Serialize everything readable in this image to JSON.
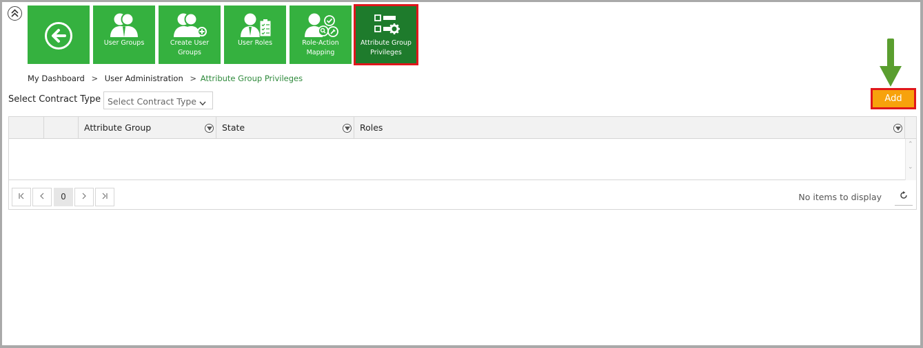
{
  "tiles": [
    {
      "label": "",
      "icon": "back-arrow-icon"
    },
    {
      "label": "User Groups",
      "icon": "user-groups-icon"
    },
    {
      "label": "Create User Groups",
      "icon": "create-user-group-icon"
    },
    {
      "label": "User Roles",
      "icon": "user-roles-icon"
    },
    {
      "label": "Role-Action Mapping",
      "icon": "role-action-mapping-icon"
    },
    {
      "label": "Attribute Group Privileges",
      "icon": "attribute-group-privileges-icon",
      "active": true
    }
  ],
  "breadcrumb": {
    "items": [
      "My Dashboard",
      "User Administration",
      "Attribute Group Privileges"
    ],
    "separator": ">"
  },
  "contract_type": {
    "label": "Select Contract Type",
    "placeholder": "Select Contract Type"
  },
  "add_button": {
    "label": "Add"
  },
  "grid": {
    "columns": [
      "",
      "",
      "Attribute Group",
      "State",
      "Roles"
    ],
    "rows": [],
    "pager": {
      "current_page": "0",
      "info": "No items to display"
    }
  },
  "colors": {
    "tile_green": "#35b13f",
    "tile_active": "#1e7b2c",
    "highlight_red": "#e0161b",
    "add_orange": "#f7a20c",
    "arrow_green": "#5a9e2f",
    "breadcrumb_current": "#2f8a3c"
  }
}
